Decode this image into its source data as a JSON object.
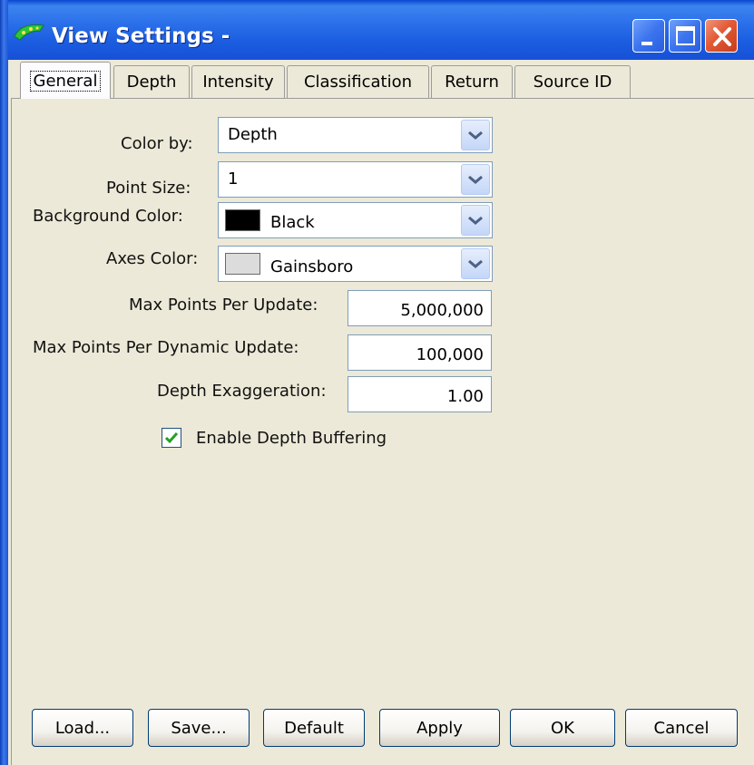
{
  "window": {
    "title": "View Settings -",
    "controls": {
      "minimize": "minimize-icon",
      "maximize": "maximize-icon",
      "close": "close-icon"
    }
  },
  "tabs": [
    {
      "label": "General",
      "active": true
    },
    {
      "label": "Depth"
    },
    {
      "label": "Intensity"
    },
    {
      "label": "Classification"
    },
    {
      "label": "Return"
    },
    {
      "label": "Source ID"
    }
  ],
  "general": {
    "color_by": {
      "label": "Color by:",
      "value": "Depth"
    },
    "point_size": {
      "label": "Point Size:",
      "value": "1"
    },
    "background_color": {
      "label": "Background Color:",
      "value": "Black",
      "swatch": "#000000"
    },
    "axes_color": {
      "label": "Axes Color:",
      "value": "Gainsboro",
      "swatch": "#dcdcdc"
    },
    "max_points_per_update": {
      "label": "Max Points Per Update:",
      "value": "5,000,000"
    },
    "max_points_per_dynamic_update": {
      "label": "Max Points Per Dynamic Update:",
      "value": "100,000"
    },
    "depth_exaggeration": {
      "label": "Depth Exaggeration:",
      "value": "1.00"
    },
    "enable_depth_buffering": {
      "label": "Enable Depth Buffering",
      "checked": true
    }
  },
  "buttons": {
    "load": "Load...",
    "save": "Save...",
    "default": "Default",
    "apply": "Apply",
    "ok": "OK",
    "cancel": "Cancel"
  }
}
